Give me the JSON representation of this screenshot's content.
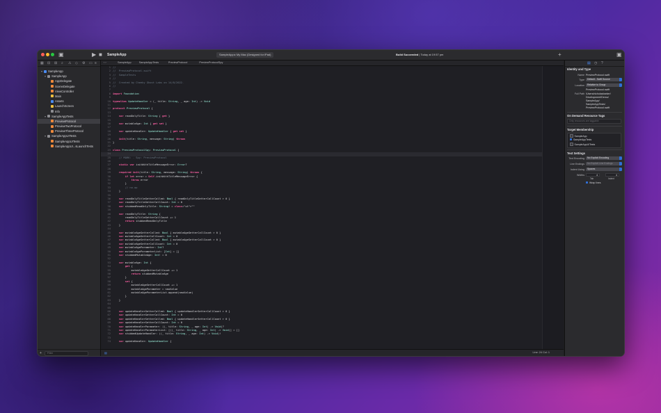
{
  "app_title": "SampleApp",
  "scheme": "SampleApp  ▸  My Mac (Designed for iPad)",
  "activity": {
    "status": "Build Succeeded",
    "time": "| Today at 19:57 pm"
  },
  "navigator": {
    "filter_placeholder": "Filter",
    "items": [
      {
        "label": "SampleApp",
        "indent": 1,
        "color": "#4a8cf7",
        "arrow": "▾"
      },
      {
        "label": "SampleApp",
        "indent": 2,
        "color": "#8e8e93",
        "arrow": "▾"
      },
      {
        "label": "AppDelegate",
        "indent": 3,
        "color": "#f08a3c",
        "arrow": ""
      },
      {
        "label": "SceneDelegate",
        "indent": 3,
        "color": "#f08a3c",
        "arrow": ""
      },
      {
        "label": "ViewController",
        "indent": 3,
        "color": "#f08a3c",
        "arrow": ""
      },
      {
        "label": "Main",
        "indent": 3,
        "color": "#f0c040",
        "arrow": ""
      },
      {
        "label": "Assets",
        "indent": 3,
        "color": "#4a8cf7",
        "arrow": ""
      },
      {
        "label": "LaunchScreen",
        "indent": 3,
        "color": "#f0c040",
        "arrow": ""
      },
      {
        "label": "Info",
        "indent": 3,
        "color": "#8e8e93",
        "arrow": ""
      },
      {
        "label": "SampleAppTests",
        "indent": 2,
        "color": "#8e8e93",
        "arrow": "▾"
      },
      {
        "label": "PreviewProtocol",
        "indent": 3,
        "color": "#f08a3c",
        "arrow": "",
        "selected": true
      },
      {
        "label": "PreviewTwoProtocol",
        "indent": 3,
        "color": "#f08a3c",
        "arrow": ""
      },
      {
        "label": "PreviewThreeProtocol",
        "indent": 3,
        "color": "#f08a3c",
        "arrow": ""
      },
      {
        "label": "SampleAppUITests",
        "indent": 2,
        "color": "#8e8e93",
        "arrow": "▾"
      },
      {
        "label": "SampleAppUITests",
        "indent": 3,
        "color": "#f08a3c",
        "arrow": ""
      },
      {
        "label": "SampleAppUI...sLaunchTests",
        "indent": 3,
        "color": "#f08a3c",
        "arrow": ""
      }
    ]
  },
  "jumpbar": [
    "SampleApp",
    "SampleAppTests",
    "PreviewProtocol",
    "PreviewProtocolSpy"
  ],
  "code_lines": [
    "//",
    "//  PreviewProtocol.swift",
    "//  SampleTests",
    "//",
    "//  Created by Cheeky Ghost Labs on 14/8/2022.",
    "//",
    "",
    "import Foundation",
    "",
    "typealias UpdateHandler = (_ title: String, _ age: Int) -> Void",
    "",
    "protocol PreviewProtocol {",
    "",
    "    var readOnlyTitle: String { get }",
    "",
    "    var mutableAge: Int { get set }",
    "",
    "    var updateHandler: UpdateHandler { get set }",
    "",
    "    init(title: String, message: String) throws",
    "}",
    "",
    "class PreviewProtocolSpy: PreviewProtocol {",
    "",
    "    // MARK: - Spy: PreviewProtocol",
    "",
    "    static var initWithTitleMessageError: Error?",
    "",
    "    required init(title: String, message: String) throws {",
    "        if let error = Self.initWithTitleMessageError {",
    "            throw error",
    "        }",
    "        // no-op",
    "    }",
    "",
    "    var readOnlyTitleGetterCalled: Bool { readOnlyTitleGetterCallCount > 0 }",
    "    var readOnlyTitleGetterCallCount: Int = 0",
    "    var stubbedReadOnlyTitle: String! = \"\"",
    "",
    "    var readOnlyTitle: String {",
    "        readOnlyTitleGetterCallCount += 1",
    "        return stubbedReadOnlyTitle",
    "    }",
    "",
    "    var mutableAgeGetterCalled: Bool { mutableAgeGetterCallCount > 0 }",
    "    var mutableAgeGetterCallCount: Int = 0",
    "    var mutableAgeSetterCalled: Bool { mutableAgeSetterCallCount > 0 }",
    "    var mutableAgeSetterCallCount: Int = 0",
    "    var mutableAgeParameter: Int?",
    "    var mutableAgeParameterList: [Int] = []",
    "    var stubbedMutableAge: Int! = 0",
    "",
    "    var mutableAge: Int {",
    "        get {",
    "            mutableAgeGetterCallCount += 1",
    "            return stubbedMutableAge",
    "        }",
    "        set {",
    "            mutableAgeSetterCallCount += 1",
    "            mutableAgeParameter = newValue",
    "            mutableAgeParameterList.append(newValue)",
    "        }",
    "    }",
    "",
    "",
    "    var updateHandlerGetterCalled: Bool { updateHandlerGetterCallCount > 0 }",
    "    var updateHandlerGetterCallCount: Int = 0",
    "    var updateHandlerSetterCalled: Bool { updateHandlerSetterCallCount > 0 }",
    "    var updateHandlerSetterCallCount: Int = 0",
    "    var updateHandlerParameter: ((_ title: String, _ age: Int) -> Void)?",
    "    var updateHandlerParameterList: [((_ title: String, _ age: Int) -> Void)] = []",
    "    var stubbedUpdateHandler: ((_ title: String, _ age: Int) -> Void)!",
    "",
    "    var updateHandler: UpdateHandler {"
  ],
  "status_position": "Line: 24  Col: 1",
  "inspector": {
    "identity_title": "Identity and Type",
    "name_label": "Name",
    "name_value": "PreviewProtocol.swift",
    "type_label": "Type",
    "type_value": "Default - Swift Source",
    "location_label": "Location",
    "location_value": "Relative to Group",
    "location_file": "PreviewProtocol.swift",
    "fullpath_label": "Full Path",
    "fullpath_lines": [
      "/Users/nicholasbarker/",
      "Development/Demo/",
      "SampleApp/",
      "SampleAppTests/",
      "PreviewProtocol.swift"
    ],
    "odr_title": "On Demand Resource Tags",
    "odr_placeholder": "Only resources are taggable",
    "target_title": "Target Membership",
    "targets": [
      {
        "label": "SampleApp",
        "checked": false
      },
      {
        "label": "SampleAppTests",
        "checked": true
      },
      {
        "label": "SampleAppUITests",
        "checked": false
      }
    ],
    "text_title": "Text Settings",
    "encoding_label": "Text Encoding",
    "encoding_value": "No Explicit Encoding",
    "endings_label": "Line Endings",
    "endings_value": "No Explicit Line Endings",
    "indent_label": "Indent Using",
    "indent_value": "Spaces",
    "widths_label": "Widths",
    "tab_value": "4",
    "indent_width_value": "4",
    "tab_label": "Tab",
    "indent_sub_label": "Indent",
    "wrap_label": "Wrap lines"
  }
}
